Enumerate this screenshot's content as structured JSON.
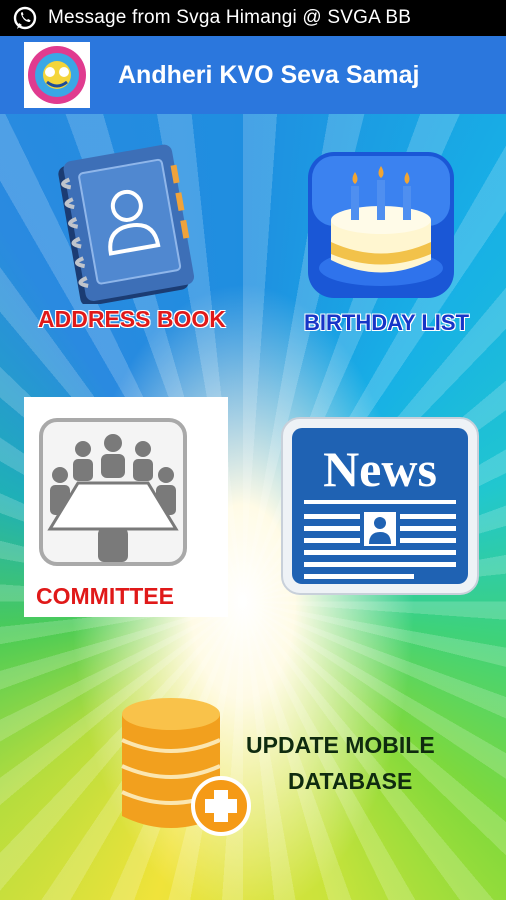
{
  "status_bar": {
    "notification": "Message from Svga Himangi @ SVGA BB"
  },
  "app_bar": {
    "title": "Andheri KVO Seva Samaj"
  },
  "menu": {
    "address_book": "ADDRESS BOOK",
    "birthday_list": "BIRTHDAY LIST",
    "committee": "COMMITTEE",
    "news_icon_text": "News",
    "update_line1": "UPDATE MOBILE",
    "update_line2": "DATABASE"
  },
  "colors": {
    "app_bar": "#2b77dd",
    "label_red": "#e01919",
    "label_blue": "#1635c7",
    "label_dark": "#0f2b0f"
  }
}
